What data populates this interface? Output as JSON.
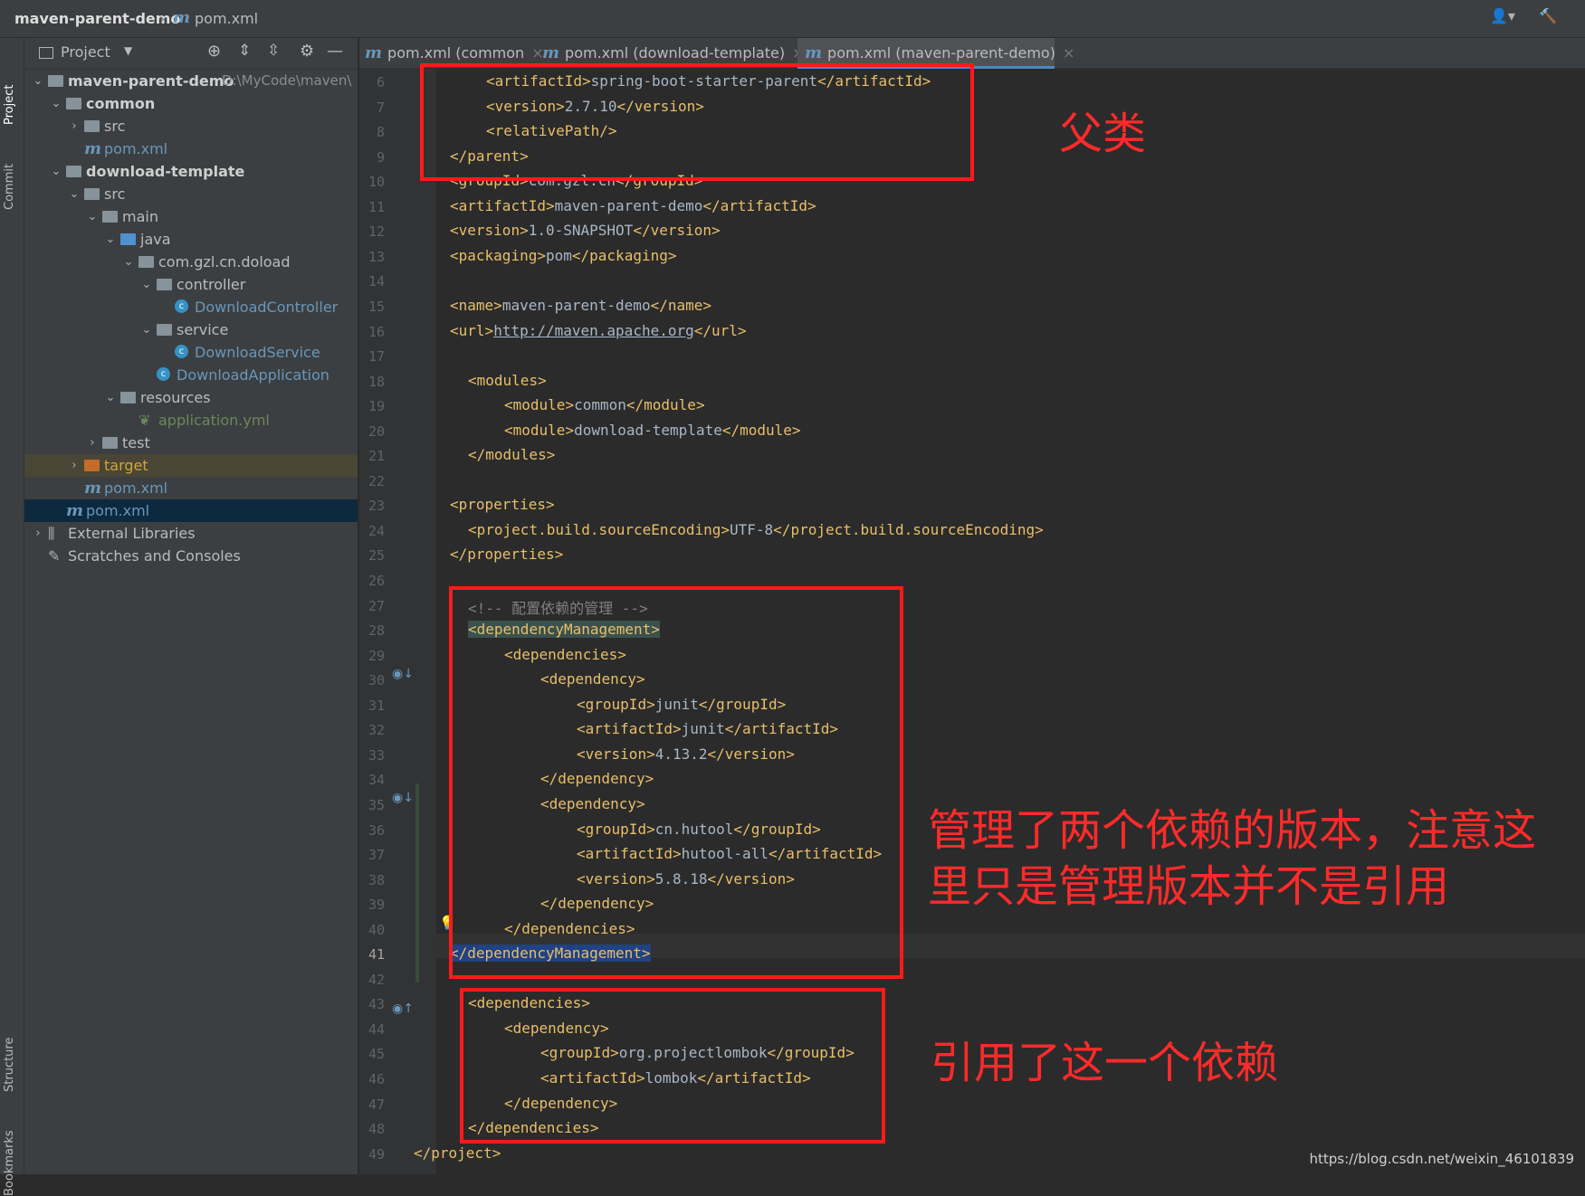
{
  "titlebar": {
    "project": "maven-parent-demo",
    "file": "pom.xml",
    "file_icon": "m"
  },
  "left_strip": {
    "project_tab": "Project",
    "commit_tab": "Commit",
    "structure_tab": "Structure",
    "bookmarks_tab": "Bookmarks"
  },
  "panel": {
    "title": "Project",
    "tree": [
      {
        "label": "maven-parent-demo",
        "extra": "D:\\MyCode\\maven\\",
        "depth": 0,
        "kind": "module",
        "expanded": true,
        "bold": true
      },
      {
        "label": "common",
        "depth": 1,
        "kind": "module",
        "expanded": true,
        "bold": true
      },
      {
        "label": "src",
        "depth": 2,
        "kind": "folder",
        "expanded": false
      },
      {
        "label": "pom.xml",
        "depth": 2,
        "kind": "pom"
      },
      {
        "label": "download-template",
        "depth": 1,
        "kind": "module",
        "expanded": true,
        "bold": true
      },
      {
        "label": "src",
        "depth": 2,
        "kind": "folder",
        "expanded": true
      },
      {
        "label": "main",
        "depth": 3,
        "kind": "folder",
        "expanded": true
      },
      {
        "label": "java",
        "depth": 4,
        "kind": "folder-blue",
        "expanded": true
      },
      {
        "label": "com.gzl.cn.doload",
        "depth": 5,
        "kind": "package",
        "expanded": true
      },
      {
        "label": "controller",
        "depth": 6,
        "kind": "package",
        "expanded": true
      },
      {
        "label": "DownloadController",
        "depth": 7,
        "kind": "class"
      },
      {
        "label": "service",
        "depth": 6,
        "kind": "package",
        "expanded": true
      },
      {
        "label": "DownloadService",
        "depth": 7,
        "kind": "class"
      },
      {
        "label": "DownloadApplication",
        "depth": 6,
        "kind": "spring-class"
      },
      {
        "label": "resources",
        "depth": 4,
        "kind": "folder",
        "expanded": true
      },
      {
        "label": "application.yml",
        "depth": 5,
        "kind": "yml"
      },
      {
        "label": "test",
        "depth": 3,
        "kind": "folder",
        "expanded": false
      },
      {
        "label": "target",
        "depth": 2,
        "kind": "folder-orange",
        "expanded": false,
        "excluded": true
      },
      {
        "label": "pom.xml",
        "depth": 2,
        "kind": "pom"
      },
      {
        "label": "pom.xml",
        "depth": 1,
        "kind": "pom",
        "selected": true
      },
      {
        "label": "External Libraries",
        "depth": 0,
        "kind": "libs",
        "expanded": false
      },
      {
        "label": "Scratches and Consoles",
        "depth": 0,
        "kind": "scratch"
      }
    ]
  },
  "tabs": [
    {
      "label": "pom.xml (common",
      "active": false
    },
    {
      "label": "pom.xml (download-template)",
      "active": false
    },
    {
      "label": "pom.xml (maven-parent-demo)",
      "active": true
    }
  ],
  "editor": {
    "current_line": 41,
    "lines": [
      {
        "n": 6,
        "indent": 2,
        "html": "<span class='br'>&lt;</span><span class='tag'>artifactId</span><span class='br'>&gt;</span>spring-boot-starter-parent<span class='br'>&lt;/</span><span class='tag'>artifactId</span><span class='br'>&gt;</span>"
      },
      {
        "n": 7,
        "indent": 2,
        "html": "<span class='br'>&lt;</span><span class='tag'>version</span><span class='br'>&gt;</span>2.7.10<span class='br'>&lt;/</span><span class='tag'>version</span><span class='br'>&gt;</span>"
      },
      {
        "n": 8,
        "indent": 2,
        "html": "<span class='br'>&lt;</span><span class='tag'>relativePath</span><span class='br'>/&gt;</span>"
      },
      {
        "n": 9,
        "indent": 1,
        "html": "<span class='br'>&lt;/</span><span class='tag'>parent</span><span class='br'>&gt;</span>"
      },
      {
        "n": 10,
        "indent": 1,
        "html": "<span class='br'>&lt;</span><span class='tag'>groupId</span><span class='br'>&gt;</span>com.gzl.cn<span class='br'>&lt;/</span><span class='tag'>groupId</span><span class='br'>&gt;</span>"
      },
      {
        "n": 11,
        "indent": 1,
        "html": "<span class='br'>&lt;</span><span class='tag'>artifactId</span><span class='br'>&gt;</span>maven-parent-demo<span class='br'>&lt;/</span><span class='tag'>artifactId</span><span class='br'>&gt;</span>"
      },
      {
        "n": 12,
        "indent": 1,
        "html": "<span class='br'>&lt;</span><span class='tag'>version</span><span class='br'>&gt;</span>1.0-SNAPSHOT<span class='br'>&lt;/</span><span class='tag'>version</span><span class='br'>&gt;</span>"
      },
      {
        "n": 13,
        "indent": 1,
        "html": "<span class='br'>&lt;</span><span class='tag'>packaging</span><span class='br'>&gt;</span>pom<span class='br'>&lt;/</span><span class='tag'>packaging</span><span class='br'>&gt;</span>"
      },
      {
        "n": 14,
        "indent": 0,
        "html": ""
      },
      {
        "n": 15,
        "indent": 1,
        "html": "<span class='br'>&lt;</span><span class='tag'>name</span><span class='br'>&gt;</span>maven-parent-demo<span class='br'>&lt;/</span><span class='tag'>name</span><span class='br'>&gt;</span>"
      },
      {
        "n": 16,
        "indent": 1,
        "html": "<span class='br'>&lt;</span><span class='tag'>url</span><span class='br'>&gt;</span><span class='url'>http://maven.apache.org</span><span class='br'>&lt;/</span><span class='tag'>url</span><span class='br'>&gt;</span>"
      },
      {
        "n": 17,
        "indent": 0,
        "html": ""
      },
      {
        "n": 18,
        "indent": 1.5,
        "html": "<span class='br'>&lt;</span><span class='tag'>modules</span><span class='br'>&gt;</span>"
      },
      {
        "n": 19,
        "indent": 2.5,
        "html": "<span class='br'>&lt;</span><span class='tag'>module</span><span class='br'>&gt;</span>common<span class='br'>&lt;/</span><span class='tag'>module</span><span class='br'>&gt;</span>"
      },
      {
        "n": 20,
        "indent": 2.5,
        "html": "<span class='br'>&lt;</span><span class='tag'>module</span><span class='br'>&gt;</span>download-template<span class='br'>&lt;/</span><span class='tag'>module</span><span class='br'>&gt;</span>"
      },
      {
        "n": 21,
        "indent": 1.5,
        "html": "<span class='br'>&lt;/</span><span class='tag'>modules</span><span class='br'>&gt;</span>"
      },
      {
        "n": 22,
        "indent": 0,
        "html": ""
      },
      {
        "n": 23,
        "indent": 1,
        "html": "<span class='br'>&lt;</span><span class='tag'>properties</span><span class='br'>&gt;</span>"
      },
      {
        "n": 24,
        "indent": 1.5,
        "html": "<span class='br'>&lt;</span><span class='tag'>project.build.sourceEncoding</span><span class='br'>&gt;</span>UTF-8<span class='br'>&lt;/</span><span class='tag'>project.build.sourceEncoding</span><span class='br'>&gt;</span>"
      },
      {
        "n": 25,
        "indent": 1,
        "html": "<span class='br'>&lt;/</span><span class='tag'>properties</span><span class='br'>&gt;</span>"
      },
      {
        "n": 26,
        "indent": 0,
        "html": ""
      },
      {
        "n": 27,
        "indent": 1.5,
        "html": "<span class='cm'>&lt;!-- 配置依赖的管理 --&gt;</span>"
      },
      {
        "n": 28,
        "indent": 1.5,
        "html": "<span class='tagbg'><span class='br'>&lt;</span><span class='tag'>dependencyManagement</span><span class='br'>&gt;</span></span>"
      },
      {
        "n": 29,
        "indent": 2.5,
        "html": "<span class='br'>&lt;</span><span class='tag'>dependencies</span><span class='br'>&gt;</span>"
      },
      {
        "n": 30,
        "indent": 3.5,
        "html": "<span class='br'>&lt;</span><span class='tag'>dependency</span><span class='br'>&gt;</span>"
      },
      {
        "n": 31,
        "indent": 4.5,
        "html": "<span class='br'>&lt;</span><span class='tag'>groupId</span><span class='br'>&gt;</span>junit<span class='br'>&lt;/</span><span class='tag'>groupId</span><span class='br'>&gt;</span>"
      },
      {
        "n": 32,
        "indent": 4.5,
        "html": "<span class='br'>&lt;</span><span class='tag'>artifactId</span><span class='br'>&gt;</span>junit<span class='br'>&lt;/</span><span class='tag'>artifactId</span><span class='br'>&gt;</span>"
      },
      {
        "n": 33,
        "indent": 4.5,
        "html": "<span class='br'>&lt;</span><span class='tag'>version</span><span class='br'>&gt;</span>4.13.2<span class='br'>&lt;/</span><span class='tag'>version</span><span class='br'>&gt;</span>"
      },
      {
        "n": 34,
        "indent": 3.5,
        "html": "<span class='br'>&lt;/</span><span class='tag'>dependency</span><span class='br'>&gt;</span>"
      },
      {
        "n": 35,
        "indent": 3.5,
        "html": "<span class='br'>&lt;</span><span class='tag'>dependency</span><span class='br'>&gt;</span>"
      },
      {
        "n": 36,
        "indent": 4.5,
        "html": "<span class='br'>&lt;</span><span class='tag'>groupId</span><span class='br'>&gt;</span>cn.hutool<span class='br'>&lt;/</span><span class='tag'>groupId</span><span class='br'>&gt;</span>"
      },
      {
        "n": 37,
        "indent": 4.5,
        "html": "<span class='br'>&lt;</span><span class='tag'>artifactId</span><span class='br'>&gt;</span>hutool-all<span class='br'>&lt;/</span><span class='tag'>artifactId</span><span class='br'>&gt;</span>"
      },
      {
        "n": 38,
        "indent": 4.5,
        "html": "<span class='br'>&lt;</span><span class='tag'>version</span><span class='br'>&gt;</span>5.8.18<span class='br'>&lt;/</span><span class='tag'>version</span><span class='br'>&gt;</span>"
      },
      {
        "n": 39,
        "indent": 3.5,
        "html": "<span class='br'>&lt;/</span><span class='tag'>dependency</span><span class='br'>&gt;</span>"
      },
      {
        "n": 40,
        "indent": 2.5,
        "html": "<span class='br'>&lt;/</span><span class='tag'>dependencies</span><span class='br'>&gt;</span>"
      },
      {
        "n": 41,
        "indent": 1,
        "html": "<span class='tagbg2'><span class='br'>&lt;/</span><span class='tag'>dependencyManagement</span><span class='br'>&gt;</span></span>"
      },
      {
        "n": 42,
        "indent": 0,
        "html": ""
      },
      {
        "n": 43,
        "indent": 1.5,
        "html": "<span class='br'>&lt;</span><span class='tag'>dependencies</span><span class='br'>&gt;</span>"
      },
      {
        "n": 44,
        "indent": 2.5,
        "html": "<span class='br'>&lt;</span><span class='tag'>dependency</span><span class='br'>&gt;</span>"
      },
      {
        "n": 45,
        "indent": 3.5,
        "html": "<span class='br'>&lt;</span><span class='tag'>groupId</span><span class='br'>&gt;</span>org.projectlombok<span class='br'>&lt;/</span><span class='tag'>groupId</span><span class='br'>&gt;</span>"
      },
      {
        "n": 46,
        "indent": 3.5,
        "html": "<span class='br'>&lt;</span><span class='tag'>artifactId</span><span class='br'>&gt;</span>lombok<span class='br'>&lt;/</span><span class='tag'>artifactId</span><span class='br'>&gt;</span>"
      },
      {
        "n": 47,
        "indent": 2.5,
        "html": "<span class='br'>&lt;/</span><span class='tag'>dependency</span><span class='br'>&gt;</span>"
      },
      {
        "n": 48,
        "indent": 1.5,
        "html": "<span class='br'>&lt;/</span><span class='tag'>dependencies</span><span class='br'>&gt;</span>"
      },
      {
        "n": 49,
        "indent": 0,
        "html": "<span class='br'>&lt;/</span><span class='tag'>project</span><span class='br'>&gt;</span>"
      }
    ]
  },
  "annotations": {
    "parent_note": "父类",
    "management_note_line1": "管理了两个依赖的版本，注意这",
    "management_note_line2": "里只是管理版本并不是引用",
    "reference_note": "引用了这一个依赖",
    "color": "#ff1a1a"
  },
  "watermark": "https://blog.csdn.net/weixin_46101839"
}
